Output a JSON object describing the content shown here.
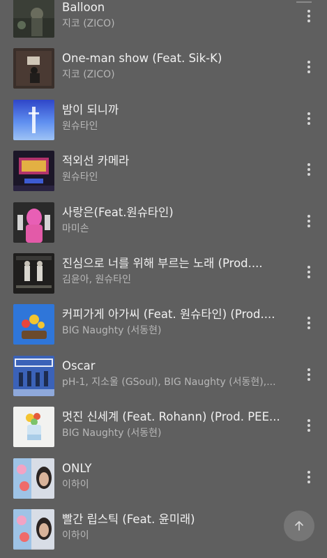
{
  "tracks": [
    {
      "title": "Balloon",
      "artist": "지코 (ZICO)"
    },
    {
      "title": "One-man show (Feat. Sik-K)",
      "artist": "지코 (ZICO)"
    },
    {
      "title": "밤이 되니까",
      "artist": "원슈타인"
    },
    {
      "title": "적외선 카메라",
      "artist": "원슈타인"
    },
    {
      "title": "사랑은(Feat.원슈타인)",
      "artist": "마미손"
    },
    {
      "title": "진심으로 너를 위해 부르는 노래 (Prod....",
      "artist": "김윤아, 원슈타인"
    },
    {
      "title": "커피가게 아가씨 (Feat. 원슈타인) (Prod....",
      "artist": "BIG Naughty (서동현)"
    },
    {
      "title": "Oscar",
      "artist": "pH-1, 지소울 (GSoul), BIG Naughty (서동현),..."
    },
    {
      "title": "멋진 신세계 (Feat. Rohann) (Prod. PEE...",
      "artist": "BIG Naughty (서동현)"
    },
    {
      "title": "ONLY",
      "artist": "이하이"
    },
    {
      "title": "빨간 립스틱 (Feat. 윤미래)",
      "artist": "이하이"
    }
  ],
  "icons": {
    "more": "more-vertical-icon",
    "scroll_top": "arrow-up-icon"
  },
  "colors": {
    "background": "#5f5f5f",
    "title": "#f1f1f1",
    "artist": "#b7b7b7"
  }
}
